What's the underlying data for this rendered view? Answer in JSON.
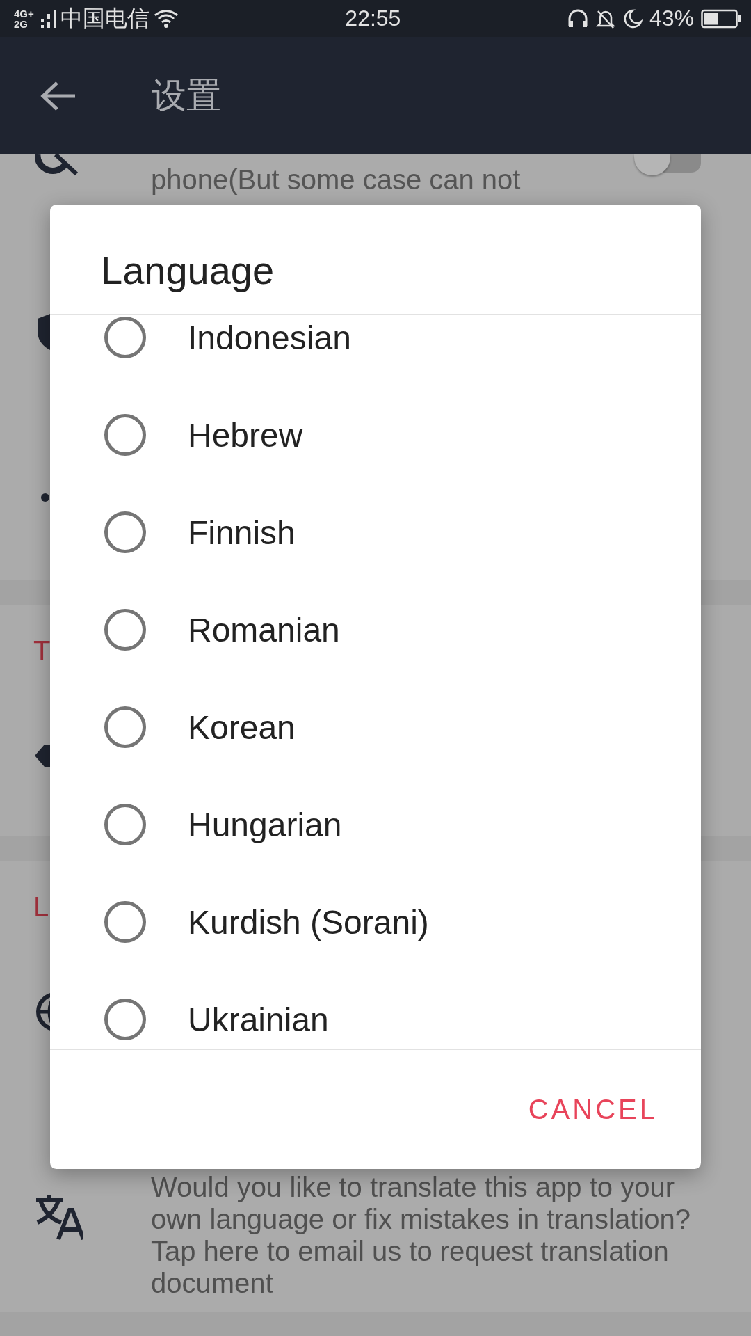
{
  "status_bar": {
    "network_top": "4G+",
    "network_bottom": "2G",
    "carrier": "中国电信",
    "time": "22:55",
    "battery": "43%"
  },
  "app_bar": {
    "title": "设置"
  },
  "settings": {
    "hide_row_text": "phone(But some case can not",
    "hide_toggle_on": false,
    "section_1_header": "T",
    "section_2_header": "L",
    "translate_description": "Would you like to translate this app to your own language or fix mistakes in translation? Tap here to email us to request translation document"
  },
  "dialog": {
    "title": "Language",
    "options": [
      {
        "label": "Indonesian",
        "selected": false
      },
      {
        "label": "Hebrew",
        "selected": false
      },
      {
        "label": "Finnish",
        "selected": false
      },
      {
        "label": "Romanian",
        "selected": false
      },
      {
        "label": "Korean",
        "selected": false
      },
      {
        "label": "Hungarian",
        "selected": false
      },
      {
        "label": "Kurdish (Sorani)",
        "selected": false
      },
      {
        "label": "Ukrainian",
        "selected": false
      }
    ],
    "buttons": [
      {
        "label": "CANCEL"
      }
    ]
  }
}
